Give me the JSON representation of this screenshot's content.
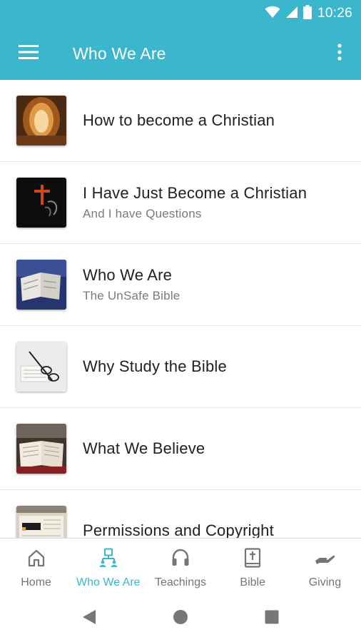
{
  "status_bar": {
    "time": "10:26"
  },
  "app_bar": {
    "title": "Who We Are"
  },
  "list": [
    {
      "title": "How to become a Christian",
      "subtitle": ""
    },
    {
      "title": "I Have Just Become a Christian",
      "subtitle": "And I have Questions"
    },
    {
      "title": "Who We Are",
      "subtitle": "The UnSafe Bible"
    },
    {
      "title": "Why Study the Bible",
      "subtitle": ""
    },
    {
      "title": "What We Believe",
      "subtitle": ""
    },
    {
      "title": "Permissions and Copyright",
      "subtitle": ""
    }
  ],
  "bottom_nav": [
    {
      "label": "Home",
      "icon": "home-icon",
      "active": false
    },
    {
      "label": "Who We Are",
      "icon": "people-network-icon",
      "active": true
    },
    {
      "label": "Teachings",
      "icon": "headphones-icon",
      "active": false
    },
    {
      "label": "Bible",
      "icon": "bible-icon",
      "active": false
    },
    {
      "label": "Giving",
      "icon": "giving-hand-icon",
      "active": false
    }
  ],
  "colors": {
    "primary": "#3bb6cc",
    "text": "#212121",
    "subtext": "#7a7a7a",
    "inactive": "#757575"
  }
}
